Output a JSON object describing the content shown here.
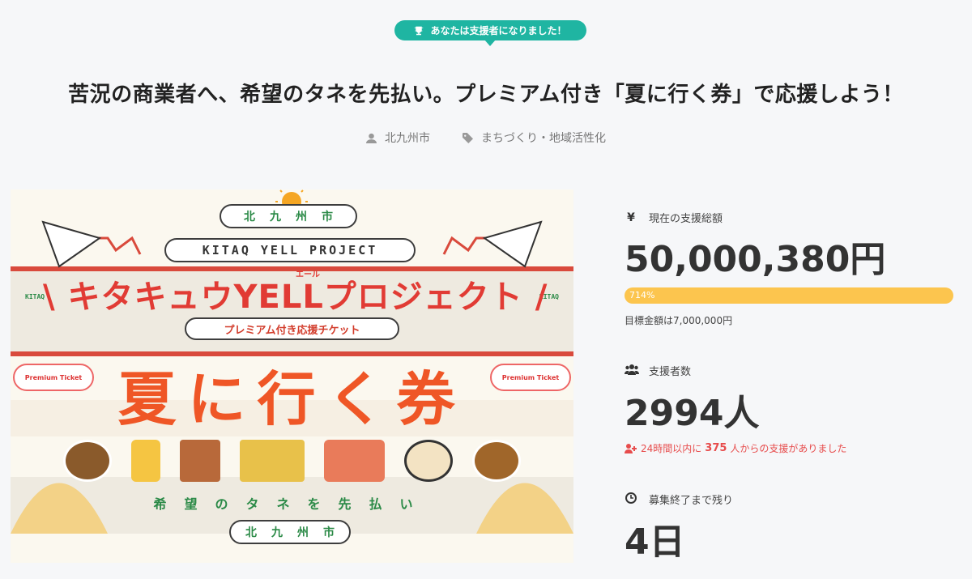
{
  "badge": {
    "icon": "trophy-icon",
    "text": "あなたは支援者になりました！"
  },
  "project": {
    "title": "苦況の商業者へ、希望のタネを先払い。プレミアム付き「夏に行く券」で応援しよう！",
    "owner": "北九州市",
    "category": "まちづくり・地域活性化"
  },
  "hero": {
    "city": "北九州市",
    "project_en": "KITAQ YELL PROJECT",
    "kitaq_small": "KITAQ",
    "name": "キタキュウYELLプロジェクト",
    "name_prefix": "\\",
    "name_suffix": "/",
    "ruby": "エール",
    "ticket_label": "プレミアム付き応援チケット",
    "ticket_name": "夏に行く券",
    "premium_tag": "Premium Ticket",
    "slogan": "希望のタネを先払い",
    "city_bottom": "北九州市"
  },
  "stats": {
    "amount": {
      "icon": "yen-icon",
      "label": "現在の支援総額",
      "value": "50,000,380円",
      "percent": "714%",
      "goal": "目標金額は7,000,000円"
    },
    "backers": {
      "icon": "users-icon",
      "label": "支援者数",
      "value": "2994人",
      "recent_prefix": "24時間以内に",
      "recent_count": "375",
      "recent_suffix": "人からの支援がありました"
    },
    "remaining": {
      "icon": "clock-icon",
      "label": "募集終了まで残り",
      "value": "4日"
    }
  },
  "colors": {
    "accent": "#1fb5a2",
    "progress": "#fcc54e",
    "alert": "#e74c4c"
  }
}
